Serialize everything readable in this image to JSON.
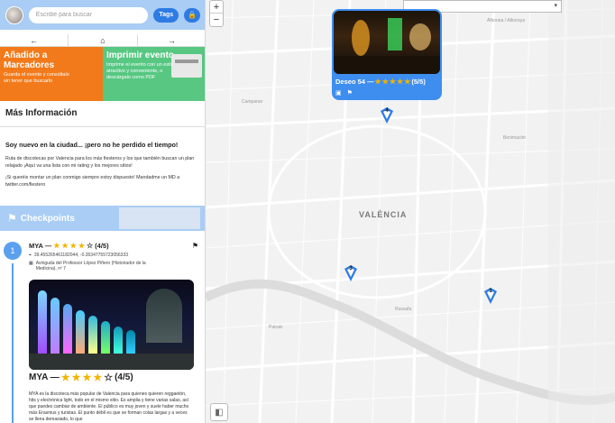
{
  "header": {
    "search_placeholder": "Escribe para buscar",
    "tags_label": "Tags",
    "lock_icon": "lock-icon"
  },
  "nav": {
    "back": "←",
    "home": "⌂",
    "forward": "→"
  },
  "promo": {
    "a_title": "Añadido a Marcadores",
    "a_text": "Guarda el evento y consúltalo sin tener que buscarlo",
    "b_title": "Imprimir evento",
    "b_text": "Imprime el evento con un estilo atractivo y conveniente, o descárgalo como PDF"
  },
  "info": {
    "title": "Más Información",
    "head": "Soy nuevo en la ciudad... ¡pero no he perdido el tiempo!",
    "p1": "Ruta de discotecas por Valencia para los más fiesteros y los que también buscan un plan relajado ¡Aquí va una lista con mi rating y los mejores sitios!",
    "p2": "¡Si queréis montar un plan conmigo siempre estoy dispuesto! Mandadme un MD a twitter.com/fiestero"
  },
  "checkpoints": {
    "label": "Checkpoints",
    "item": {
      "number": "1",
      "name": "MYA —",
      "rating": "(4/5)",
      "coords": "39.455265461182044, -0.35347755723056333",
      "address": "Avinguda del Professor López Piñero (Historiador de la Medicina), nº 7",
      "big_name": "MYA —",
      "big_rating": "(4/5)",
      "description": "MYA es la discoteca más popular de Valencia para quienes quieren reggaetón, hits y electrónica light, todo en el mismo sitio. Es amplia y tiene varias salas, así que puedes cambiar de ambiente. El público es muy joven y suele haber mucho más Erasmus y turistas. El punto débil es que se forman colas largas y a veces se llena demasiado, lo que"
    }
  },
  "map": {
    "popup_title": "Deseo 54 —",
    "popup_rating": "(5/5)",
    "city": "VALÈNCIA",
    "zoom_in": "+",
    "zoom_out": "−",
    "pins": [
      "4",
      "3",
      "1"
    ],
    "labels": [
      "Alboraia / Alboraya",
      "Benimaclet",
      "Patraix",
      "Campanar",
      "Russafa"
    ]
  },
  "colors": {
    "accent": "#2e7be4",
    "header_bg": "#a9cdf5",
    "promo_a": "#f27a1a",
    "promo_b": "#57c782",
    "star": "#f2b400"
  }
}
